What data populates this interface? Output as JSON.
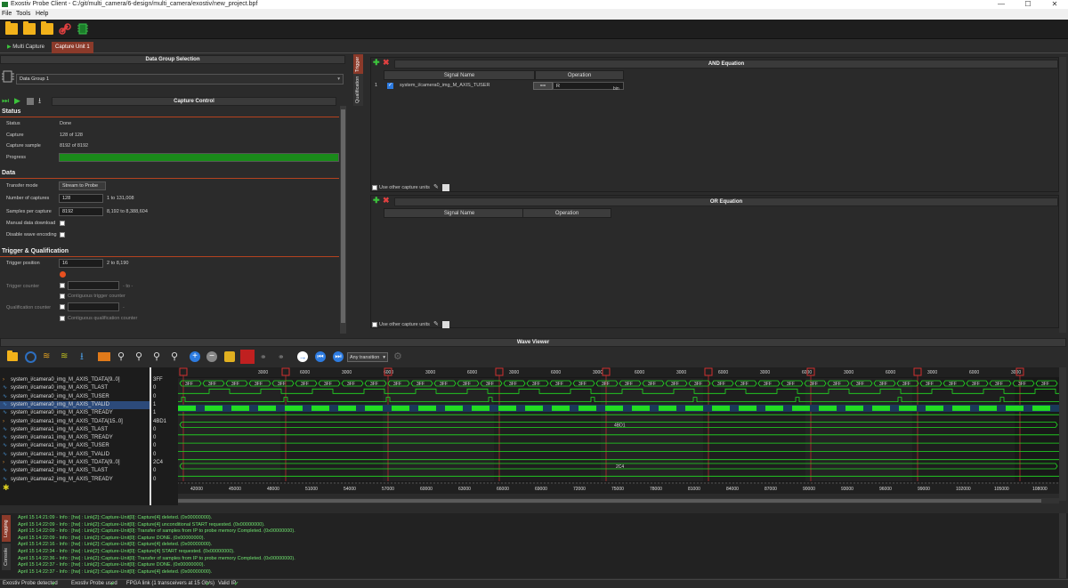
{
  "window": {
    "title": "Exostiv Probe Client - C:/git/multi_camera/6-design/multi_camera/exostiv/new_project.bpf",
    "minimize": "—",
    "maximize": "☐",
    "close": "✕"
  },
  "menu": [
    "File",
    "Tools",
    "Help"
  ],
  "tabs": [
    {
      "label": "Multi Capture"
    },
    {
      "label": "Capture Unit 1"
    }
  ],
  "data_group": {
    "header": "Data Group Selection",
    "selected": "Data Group 1"
  },
  "capture_control": {
    "header": "Capture Control",
    "status_section": "Status",
    "status_label": "Status",
    "status_value": "Done",
    "capture_label": "Capture",
    "capture_value": "128 of 128",
    "capture_sample_label": "Capture sample",
    "capture_sample_value": "8192 of 8192",
    "progress_label": "Progress",
    "progress_fraction": 1.0,
    "data_section": "Data",
    "transfer_mode_label": "Transfer mode",
    "transfer_mode_value": "Stream to Probe",
    "num_captures_label": "Number of captures",
    "num_captures_value": "128",
    "num_captures_range": "1 to 131,008",
    "samples_label": "Samples per capture",
    "samples_value": "8192",
    "samples_range": "8,192 to 8,388,604",
    "manual_download_label": "Manual data download",
    "disable_wave_label": "Disable wave encoding",
    "trigger_section": "Trigger & Qualification",
    "trigger_position_label": "Trigger position",
    "trigger_position_value": "16",
    "trigger_position_range": "2 to 8,190",
    "trigger_counter_label": "Trigger counter",
    "trigger_counter_suffix": "- to -",
    "contiguous_trigger_label": "Contiguous trigger counter",
    "qualification_counter_label": "Qualification counter",
    "qualification_counter_suffix": "-",
    "contiguous_qual_label": "Contiguous qualification counter"
  },
  "side_tabs": {
    "trigger": "Trigger",
    "qualification": "Qualification",
    "logging": "Logging",
    "console": "Console"
  },
  "and_equation": {
    "header": "AND Equation",
    "col_signal": "Signal Name",
    "col_operation": "Operation",
    "rows": [
      {
        "index": "1",
        "signal": "system_i/camera0_img_M_AXIS_TUSER",
        "op": "==",
        "value": "R",
        "format": "bin"
      }
    ],
    "use_other_label": "Use other capture units"
  },
  "or_equation": {
    "header": "OR Equation",
    "col_signal": "Signal Name",
    "col_operation": "Operation",
    "use_other_label": "Use other capture units"
  },
  "wave_viewer": {
    "header": "Wave Viewer",
    "transition_select": "Any transition",
    "signals": [
      {
        "name": "system_i/camera0_img_M_AXIS_TDATA[9..0]",
        "value": "3FF",
        "bus": true
      },
      {
        "name": "system_i/camera0_img_M_AXIS_TLAST",
        "value": "0",
        "bus": false
      },
      {
        "name": "system_i/camera0_img_M_AXIS_TUSER",
        "value": "0",
        "bus": false
      },
      {
        "name": "system_i/camera0_img_M_AXIS_TVALID",
        "value": "1",
        "bus": false
      },
      {
        "name": "system_i/camera0_img_M_AXIS_TREADY",
        "value": "1",
        "bus": false
      },
      {
        "name": "system_i/camera1_img_M_AXIS_TDATA[15..0]",
        "value": "4BD1",
        "bus": true
      },
      {
        "name": "system_i/camera1_img_M_AXIS_TLAST",
        "value": "0",
        "bus": false
      },
      {
        "name": "system_i/camera1_img_M_AXIS_TREADY",
        "value": "0",
        "bus": false
      },
      {
        "name": "system_i/camera1_img_M_AXIS_TUSER",
        "value": "0",
        "bus": false
      },
      {
        "name": "system_i/camera1_img_M_AXIS_TVALID",
        "value": "0",
        "bus": false
      },
      {
        "name": "system_i/camera2_img_M_AXIS_TDATA[9..0]",
        "value": "2C4",
        "bus": true
      },
      {
        "name": "system_i/camera2_img_M_AXIS_TLAST",
        "value": "0",
        "bus": false
      },
      {
        "name": "system_i/camera2_img_M_AXIS_TREADY",
        "value": "0",
        "bus": false
      }
    ],
    "bus_labels": {
      "cam0": "3FF",
      "cam1": "4BD1",
      "cam2": "2C4"
    },
    "top_ticks": [
      "3000",
      "6000",
      "3000",
      "6000",
      "3000",
      "6000",
      "3000",
      "6000",
      "3000",
      "6000",
      "3000",
      "6000",
      "3000",
      "6000",
      "3000",
      "6000",
      "3000",
      "6000",
      "3000",
      "6000"
    ],
    "bottom_ticks": [
      "42000",
      "45000",
      "48000",
      "51000",
      "54000",
      "57000",
      "60000",
      "63000",
      "66000",
      "69000",
      "72000",
      "75000",
      "78000",
      "81000",
      "84000",
      "87000",
      "90000",
      "93000",
      "96000",
      "99000",
      "102000",
      "105000",
      "108000"
    ]
  },
  "log": [
    "April 15 14:21:09 - Info : [hw] : Link[2]::Capture-Unit[0]: Capture[4] deleted. (0x00000000).",
    "April 15 14:22:09 - Info : [hw] : Link[2]::Capture-Unit[0]: Capture[4] unconditional START requested. (0x00000000).",
    "April 15 14:22:09 - Info : [hw] : Link[2]::Capture-Unit[0]: Transfer of samples from IP to probe memory Completed. (0x00000000).",
    "April 15 14:22:09 - Info : [hw] : Link[2]::Capture-Unit[0]: Capture DONE. (0x00000000).",
    "April 15 14:22:16 - Info : [hw] : Link[2]::Capture-Unit[0]: Capture[4] deleted. (0x00000000).",
    "April 15 14:22:34 - Info : [hw] : Link[2]::Capture-Unit[0]: Capture[4] START requested. (0x00000000).",
    "April 15 14:22:36 - Info : [hw] : Link[2]::Capture-Unit[0]: Transfer of samples from IP to probe memory Completed. (0x00000000).",
    "April 15 14:22:37 - Info : [hw] : Link[2]::Capture-Unit[0]: Capture DONE. (0x00000000).",
    "April 15 14:22:37 - Info : [hw] : Link[2]::Capture-Unit[0]: Capture[4] deleted. (0x00000000)."
  ],
  "status_bar": {
    "probe_detected": "Exostiv Probe detected",
    "probe_used": "Exostiv Probe used",
    "fpga_link": "FPGA link  (1 transceivers at 15 Gb/s)",
    "valid_ip": "Valid IP",
    "check": "✔"
  },
  "colors": {
    "accent": "#b5421f",
    "wave_green": "#22dd22",
    "progress": "#1a8a1a",
    "log_text": "#6fe36f"
  }
}
